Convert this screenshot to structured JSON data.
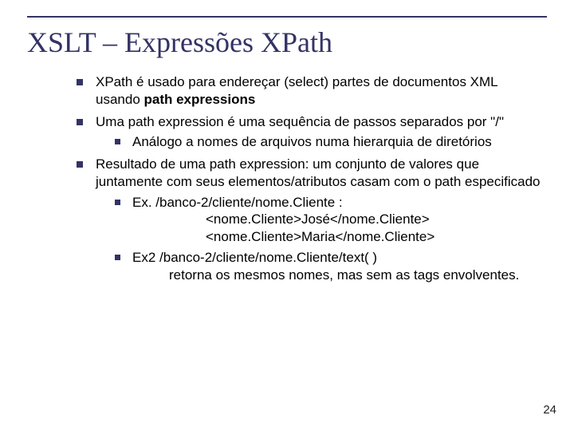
{
  "title": "XSLT – Expressões XPath",
  "bullets": {
    "b1a": "XPath é usado para endereçar (select) partes de documentos XML usando ",
    "b1b": "path expressions",
    "b2": "Uma path expression é uma sequência de passos separados por \"/\"",
    "b2_1": "Análogo a nomes de arquivos numa hierarquia de diretórios",
    "b3": "Resultado de uma path expression:  um conjunto de valores que juntamente com seus elementos/atributos casam com o path especificado",
    "b3_1_lead": "Ex.         /banco-2/cliente/nome.Cliente   :",
    "b3_1_l2": "<nome.Cliente>José</nome.Cliente>",
    "b3_1_l3": "<nome.Cliente>Maria</nome.Cliente>",
    "b3_2_lead": "Ex2        /banco-2/cliente/nome.Cliente/text( )",
    "b3_2_tail": "retorna os mesmos nomes, mas sem as tags envolventes."
  },
  "page": "24"
}
